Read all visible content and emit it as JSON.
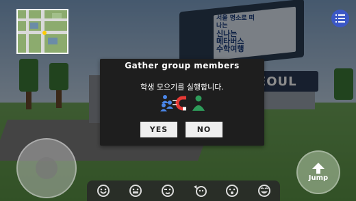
{
  "scene": {
    "billboard_text": [
      "서울 명소로 떠나는",
      "신나는",
      "메타버스",
      "수학여행"
    ],
    "sign_text": "SEOUL"
  },
  "dialog": {
    "title": "Gather group members",
    "message": "학생 모으기를 실행합니다.",
    "yes_label": "YES",
    "no_label": "NO",
    "icon": "magnet-gather-icon"
  },
  "controls": {
    "jump_label": "Jump"
  },
  "emotes": [
    "laugh-emote-icon",
    "cheer-emote-icon",
    "wink-emote-icon",
    "wave-emote-icon",
    "shock-emote-icon",
    "happy-emote-icon"
  ],
  "colors": {
    "dialog_bg": "#1e1e1e",
    "button_bg": "#efefef",
    "menu_button": "#3b57c5",
    "icon_students_blue": "#4a86e8",
    "icon_teacher_green": "#2e9c5a",
    "magnet_red": "#e53935"
  }
}
